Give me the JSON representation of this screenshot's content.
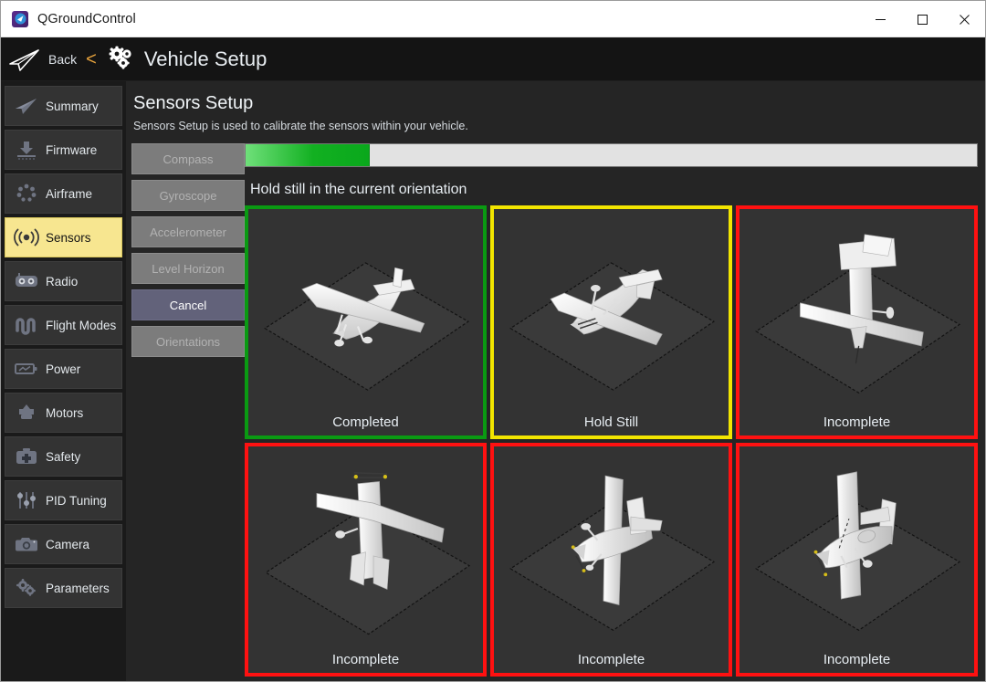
{
  "window": {
    "title": "QGroundControl",
    "app_icon": "qgc-logo-icon",
    "controls": {
      "minimize": "minimize-icon",
      "maximize": "maximize-icon",
      "close": "close-icon"
    }
  },
  "navbar": {
    "plane_icon": "paper-plane-icon",
    "back_label": "Back",
    "chevron": "<",
    "gears_icon": "gears-icon",
    "title": "Vehicle Setup",
    "chevron_color": "#e6a23c"
  },
  "sidebar": {
    "items": [
      {
        "label": "Summary",
        "icon": "paper-plane-icon",
        "active": false
      },
      {
        "label": "Firmware",
        "icon": "firmware-download-icon",
        "active": false
      },
      {
        "label": "Airframe",
        "icon": "airframe-rotor-icon",
        "active": false
      },
      {
        "label": "Sensors",
        "icon": "sensors-signal-icon",
        "active": true
      },
      {
        "label": "Radio",
        "icon": "radio-transmitter-icon",
        "active": false
      },
      {
        "label": "Flight Modes",
        "icon": "flight-modes-wave-icon",
        "active": false
      },
      {
        "label": "Power",
        "icon": "battery-icon",
        "active": false
      },
      {
        "label": "Motors",
        "icon": "motors-icon",
        "active": false
      },
      {
        "label": "Safety",
        "icon": "safety-medkit-icon",
        "active": false
      },
      {
        "label": "PID Tuning",
        "icon": "sliders-icon",
        "active": false
      },
      {
        "label": "Camera",
        "icon": "camera-icon",
        "active": false
      },
      {
        "label": "Parameters",
        "icon": "gears-icon",
        "active": false
      }
    ],
    "active_highlight_color": "#f7e690"
  },
  "main": {
    "page_title": "Sensors Setup",
    "page_subtitle": "Sensors Setup is used to calibrate the sensors within your vehicle.",
    "buttons": [
      {
        "label": "Compass",
        "enabled": false
      },
      {
        "label": "Gyroscope",
        "enabled": false
      },
      {
        "label": "Accelerometer",
        "enabled": false
      },
      {
        "label": "Level Horizon",
        "enabled": false
      },
      {
        "label": "Cancel",
        "enabled": true
      },
      {
        "label": "Orientations",
        "enabled": false
      }
    ],
    "progress": {
      "percent": 17,
      "fill_color": "#12b021",
      "track_color": "#e2e2e2"
    },
    "status_text": "Hold still in the current orientation",
    "orientation_tiles": [
      {
        "label": "Completed",
        "state": "green",
        "orientation": "level",
        "border_color": "#0a9a12"
      },
      {
        "label": "Hold Still",
        "state": "yellow",
        "orientation": "upside-down",
        "border_color": "#f2e500"
      },
      {
        "label": "Incomplete",
        "state": "red",
        "orientation": "nose-up",
        "border_color": "#ff1111"
      },
      {
        "label": "Incomplete",
        "state": "red",
        "orientation": "nose-down",
        "border_color": "#ff1111"
      },
      {
        "label": "Incomplete",
        "state": "red",
        "orientation": "left-side",
        "border_color": "#ff1111"
      },
      {
        "label": "Incomplete",
        "state": "red",
        "orientation": "right-side",
        "border_color": "#ff1111"
      }
    ]
  }
}
